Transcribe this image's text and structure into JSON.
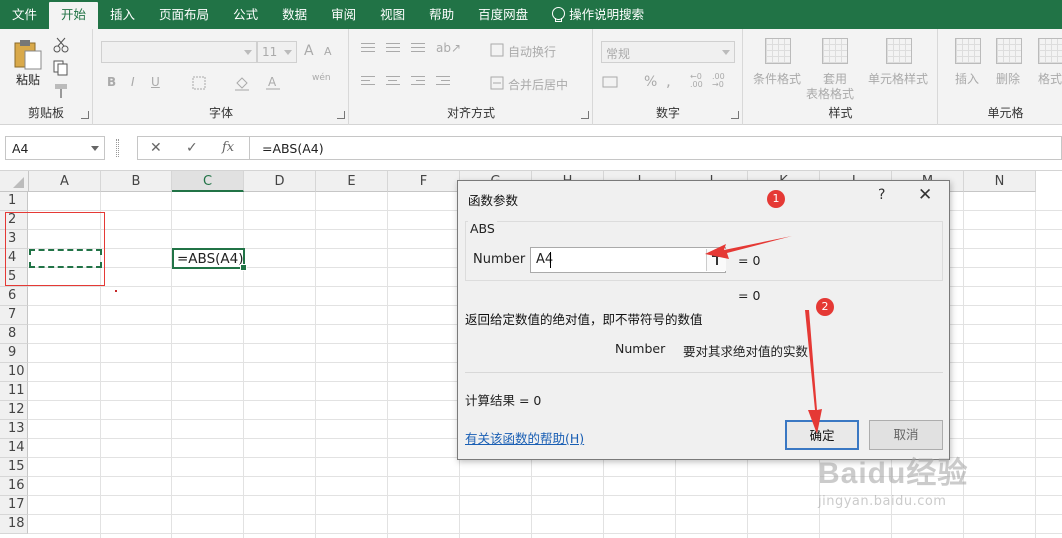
{
  "menu": {
    "tabs": [
      "文件",
      "开始",
      "插入",
      "页面布局",
      "公式",
      "数据",
      "审阅",
      "视图",
      "帮助",
      "百度网盘"
    ],
    "active_index": 1,
    "search_label": "操作说明搜索"
  },
  "ribbon": {
    "clipboard": {
      "paste": "粘贴",
      "label": "剪贴板"
    },
    "font": {
      "size": "11",
      "bold": "B",
      "italic": "I",
      "underline": "U",
      "grow": "A",
      "shrink": "A",
      "phonetic": "wén",
      "label": "字体"
    },
    "alignment": {
      "wrap": "自动换行",
      "merge": "合并后居中",
      "label": "对齐方式"
    },
    "number": {
      "format": "常规",
      "percent": "%",
      "comma": ",",
      "label": "数字"
    },
    "styles": {
      "conditional": "条件格式",
      "table_line1": "套用",
      "table_line2": "表格格式",
      "cell_styles": "单元格样式",
      "label": "样式"
    },
    "cells": {
      "insert": "插入",
      "delete": "删除",
      "format": "格式",
      "label": "单元格"
    }
  },
  "formula_bar": {
    "name_box": "A4",
    "cancel": "✕",
    "enter": "✓",
    "fx": "fx",
    "formula": "=ABS(A4)"
  },
  "grid": {
    "columns": [
      "A",
      "B",
      "C",
      "D",
      "E",
      "F",
      "G",
      "H",
      "I",
      "J",
      "K",
      "L",
      "M",
      "N"
    ],
    "rows": [
      "1",
      "2",
      "3",
      "4",
      "5",
      "6",
      "7",
      "8",
      "9",
      "10",
      "11",
      "12",
      "13",
      "14",
      "15",
      "16",
      "17",
      "18"
    ],
    "selected_column": "C",
    "c4_text": "=ABS(A4)"
  },
  "dialog": {
    "title": "函数参数",
    "help": "?",
    "close": "✕",
    "function_name": "ABS",
    "arg_label": "Number",
    "arg_value": "A4",
    "arg_result": "=   0",
    "func_result": "=   0",
    "description": "返回给定数值的绝对值，即不带符号的数值",
    "arg_desc_name": "Number",
    "arg_desc_text": "要对其求绝对值的实数",
    "calc_result": "计算结果 =   0",
    "help_link": "有关该函数的帮助(H)",
    "ok": "确定",
    "cancel": "取消"
  },
  "annotations": {
    "badge1": "1",
    "badge2": "2",
    "watermark": "Baidu经验",
    "watermark_sub": "jingyan.baidu.com"
  },
  "colors": {
    "excel_green": "#217346",
    "annotation_red": "#e53935",
    "link_blue": "#1a5fb4"
  }
}
